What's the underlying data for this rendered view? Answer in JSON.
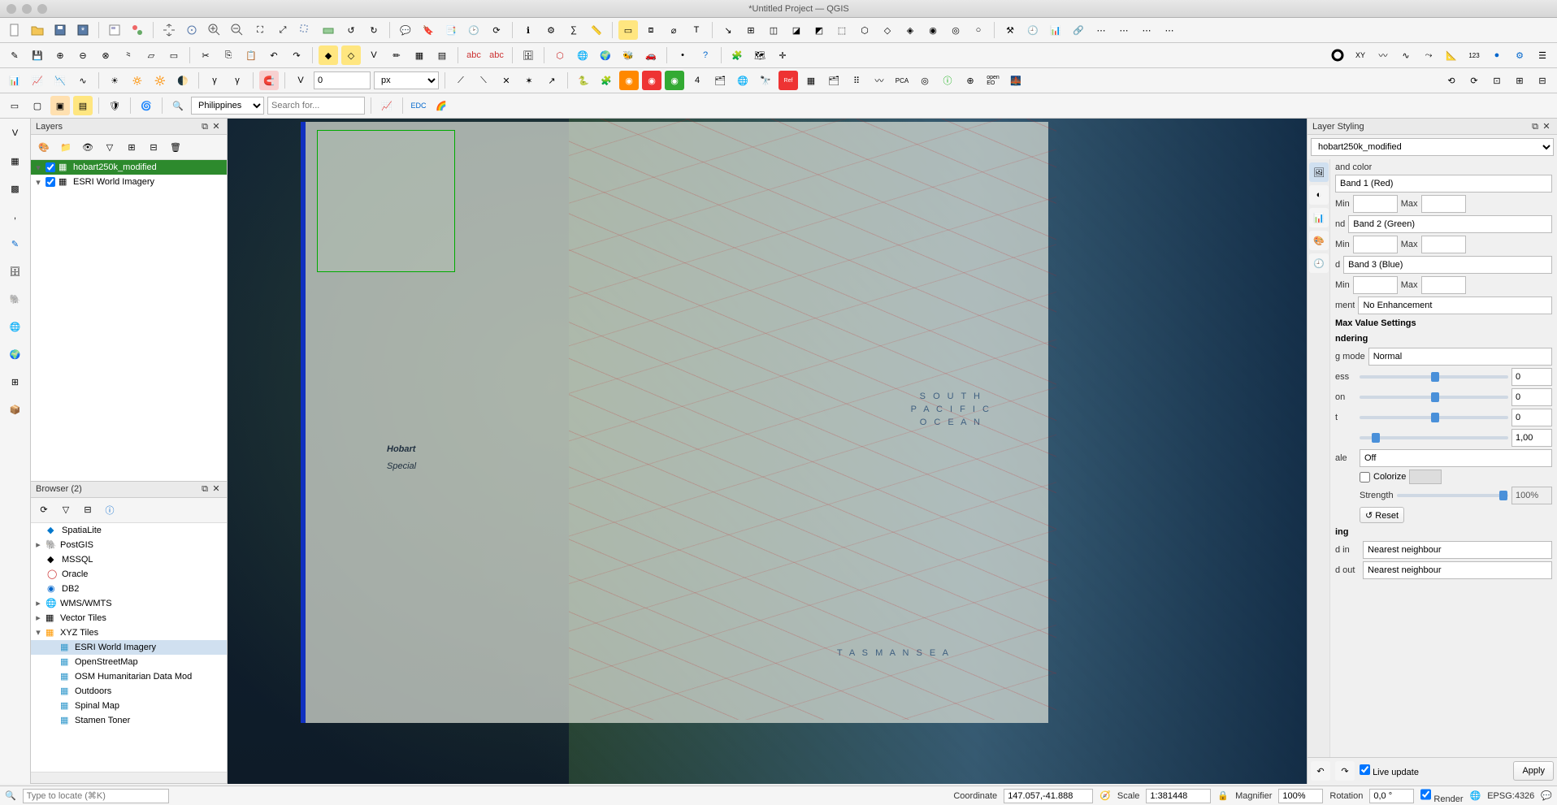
{
  "window": {
    "title": "*Untitled Project — QGIS"
  },
  "toolbar2": {
    "spin": "0",
    "unit": "px"
  },
  "toolbar3": {
    "region": "Philippines",
    "search_ph": "Search for..."
  },
  "layers": {
    "title": "Layers",
    "items": [
      {
        "name": "hobart250k_modified",
        "checked": true,
        "selected": true
      },
      {
        "name": "ESRI World Imagery",
        "checked": true,
        "selected": false
      }
    ]
  },
  "browser": {
    "title": "Browser (2)",
    "items": [
      "SpatiaLite",
      "PostGIS",
      "MSSQL",
      "Oracle",
      "DB2",
      "WMS/WMTS",
      "Vector Tiles",
      "XYZ Tiles",
      "ESRI World Imagery",
      "OpenStreetMap",
      "OSM Humanitarian Data Mod",
      "Outdoors",
      "Spinal Map",
      "Stamen Toner"
    ]
  },
  "map": {
    "title_text": "Hobart",
    "subtitle": "Special",
    "sea1a": "S O U T H",
    "sea1b": "P A C I F I C",
    "sea1c": "O C E A N",
    "sea2": "T A S M A N   S E A"
  },
  "styling": {
    "title": "Layer Styling",
    "layer": "hobart250k_modified",
    "band_color_label": "and color",
    "band1": "Band 1 (Red)",
    "band2": "Band 2 (Green)",
    "band3": "Band 3 (Blue)",
    "min": "Min",
    "max": "Max",
    "nd": "nd",
    "d": "d",
    "enh_label": "ment",
    "enh_value": "No Enhancement",
    "minmax_heading": "Max Value Settings",
    "rendering_heading": "ndering",
    "mode_label": "g mode",
    "mode_value": "Normal",
    "brightness_label": "ess",
    "brightness": "0",
    "saturation_label": "on",
    "saturation": "0",
    "contrast_label": "t",
    "contrast": "0",
    "gamma": "1,00",
    "grayscale_label": "ale",
    "grayscale": "Off",
    "colorize": "Colorize",
    "strength_label": "Strength",
    "strength": "100%",
    "reset": "Reset",
    "resampling_heading": "ing",
    "zin_label": "d in",
    "zin": "Nearest neighbour",
    "zout_label": "d out",
    "zout": "Nearest neighbour",
    "live": "Live update",
    "apply": "Apply"
  },
  "status": {
    "locator_ph": "Type to locate (⌘K)",
    "coord_label": "Coordinate",
    "coord": "147.057,-41.888",
    "scale_label": "Scale",
    "scale": "1:381448",
    "mag_label": "Magnifier",
    "mag": "100%",
    "rot_label": "Rotation",
    "rot": "0,0 °",
    "render": "Render",
    "crs": "EPSG:4326"
  }
}
